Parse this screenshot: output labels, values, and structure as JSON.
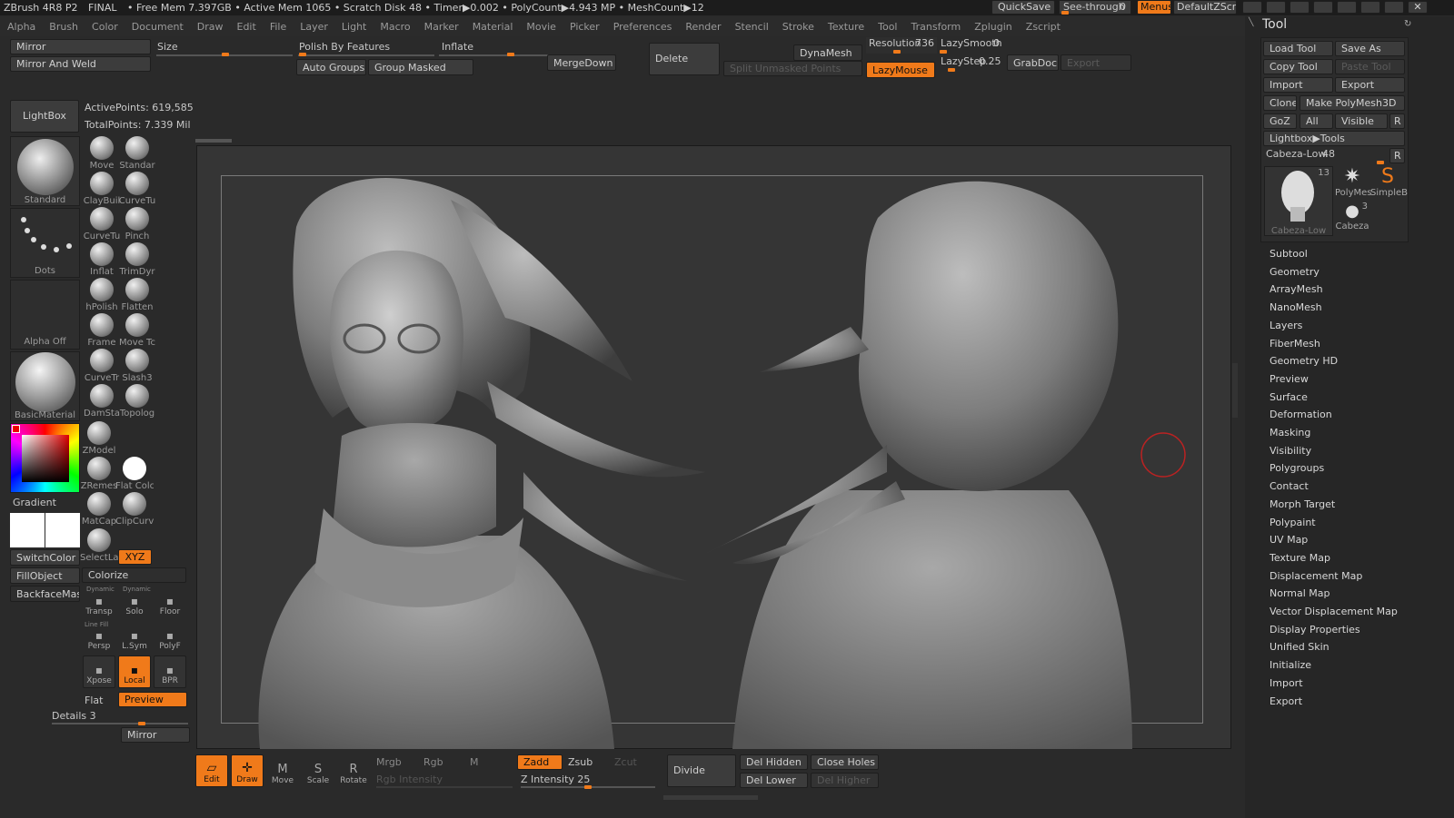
{
  "titlebar": {
    "app": "ZBrush 4R8 P2",
    "doc": "FINAL",
    "stats": "• Free Mem 7.397GB • Active Mem 1065 • Scratch Disk 48 • Timer▶0.002 • PolyCount▶4.943 MP • MeshCount▶12",
    "quicksave": "QuickSave",
    "seethrough": "See-through",
    "seethrough_val": "0",
    "menus": "Menus",
    "defaultzscript": "DefaultZScript"
  },
  "menubar": {
    "items": [
      "Alpha",
      "Brush",
      "Color",
      "Document",
      "Draw",
      "Edit",
      "File",
      "Layer",
      "Light",
      "Macro",
      "Marker",
      "Material",
      "Movie",
      "Picker",
      "Preferences",
      "Render",
      "Stencil",
      "Stroke",
      "Texture",
      "Tool",
      "Transform",
      "Zplugin",
      "Zscript"
    ]
  },
  "toolbar": {
    "mirror": "Mirror",
    "mirror_weld": "Mirror And Weld",
    "size": "Size",
    "polish": "Polish By Features",
    "inflate": "Inflate",
    "auto_groups": "Auto Groups",
    "group_masked": "Group Masked",
    "mergedown": "MergeDown",
    "delete": "Delete",
    "split": "Split Unmasked Points",
    "dynamesh": "DynaMesh",
    "resolution": "Resolution",
    "resolution_val": "736",
    "lazysmooth": "LazySmooth",
    "lazysmooth_val": "0",
    "lazymouse": "LazyMouse",
    "lazystep": "LazyStep",
    "lazystep_val": "0.25",
    "grabdoc": "GrabDoc",
    "export": "Export"
  },
  "leftpanel": {
    "lightbox": "LightBox",
    "active_points": "ActivePoints: 619,585",
    "total_points": "TotalPoints: 7.339 Mil",
    "standard": "Standard",
    "dots": "Dots",
    "alpha_off": "Alpha Off",
    "basic_material": "BasicMaterial",
    "gradient": "Gradient",
    "switch_color": "SwitchColor",
    "fill_object": "FillObject",
    "backface_mask": "BackfaceMask",
    "colorize": "Colorize",
    "xyz": "XYZ",
    "flat": "Flat",
    "preview": "Preview",
    "details": "Details",
    "details_val": "3",
    "mirror_btn": "Mirror",
    "brushes": [
      "Move",
      "Standar",
      "ClayBuil",
      "CurveTu",
      "CurveTu",
      "Pinch",
      "Inflat",
      "TrimDyr",
      "hPolish",
      "Flatten",
      "Frame",
      "Move Tc",
      "CurveTr",
      "Slash3",
      "DamSta",
      "Topolog",
      "ZModel",
      "ZRemes",
      "Flat Colc",
      "MatCap",
      "ClipCurv",
      "SelectLa"
    ],
    "view_btns": [
      "Transp",
      "Solo",
      "Floor",
      "Persp",
      "L.Sym",
      "PolyF",
      "Xpose",
      "Local",
      "BPR"
    ],
    "view_sub": [
      "Dynamic",
      "Dynamic",
      "Line Fill"
    ]
  },
  "bottombar": {
    "edit": "Edit",
    "draw": "Draw",
    "move": "Move",
    "scale": "Scale",
    "rotate": "Rotate",
    "mrgb": "Mrgb",
    "rgb": "Rgb",
    "m": "M",
    "zadd": "Zadd",
    "zsub": "Zsub",
    "zcut": "Zcut",
    "rgb_intensity": "Rgb Intensity",
    "z_intensity": "Z Intensity",
    "z_intensity_val": "25",
    "divide": "Divide",
    "del_hidden": "Del Hidden",
    "close_holes": "Close Holes",
    "del_lower": "Del Lower",
    "del_higher": "Del Higher"
  },
  "rightpanel": {
    "title": "Tool",
    "load_tool": "Load Tool",
    "save_as": "Save As",
    "copy_tool": "Copy Tool",
    "paste_tool": "Paste Tool",
    "import": "Import",
    "export": "Export",
    "clone": "Clone",
    "make_polymesh": "Make PolyMesh3D",
    "goz": "GoZ",
    "all": "All",
    "visible": "Visible",
    "r": "R",
    "lightbox_tools": "Lightbox▶Tools",
    "current_tool": "Cabeza-Low.",
    "current_tool_val": "48",
    "thumb_main": "Cabeza-Low",
    "thumb_main_count": "13",
    "thumb_polymesh": "PolyMes",
    "thumb_simple": "SimpleB",
    "thumb_cabeza": "Cabeza",
    "thumb_cabeza_count": "3",
    "menu": [
      "Subtool",
      "Geometry",
      "ArrayMesh",
      "NanoMesh",
      "Layers",
      "FiberMesh",
      "Geometry HD",
      "Preview",
      "Surface",
      "Deformation",
      "Masking",
      "Visibility",
      "Polygroups",
      "Contact",
      "Morph Target",
      "Polypaint",
      "UV Map",
      "Texture Map",
      "Displacement Map",
      "Normal Map",
      "Vector Displacement Map",
      "Display Properties",
      "Unified Skin",
      "Initialize",
      "Import",
      "Export"
    ]
  },
  "colors": {
    "accent": "#f07a1a",
    "background": "#2a2a2a",
    "viewport": "#353535"
  }
}
